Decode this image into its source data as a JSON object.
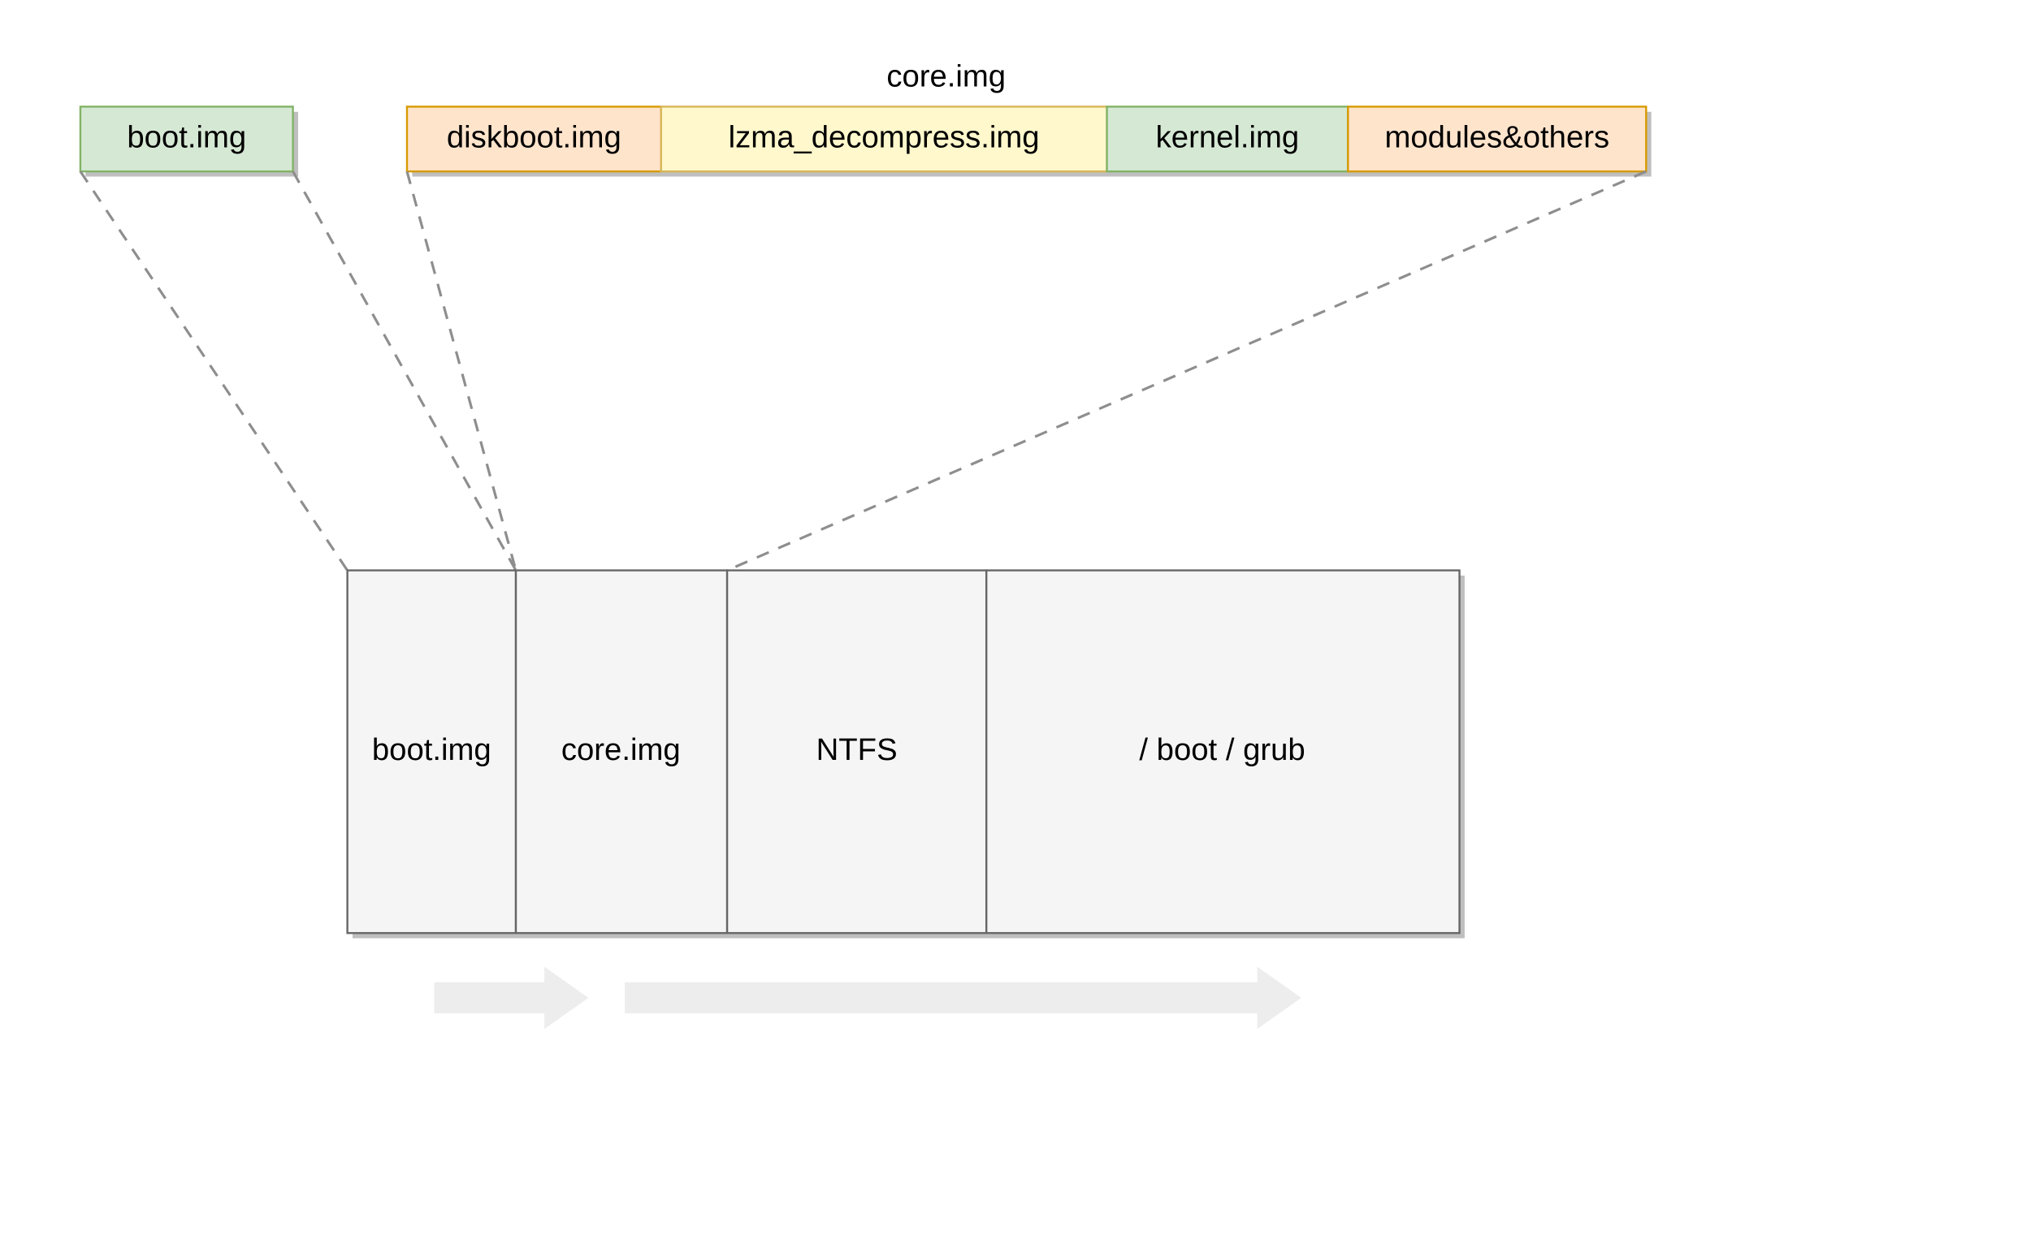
{
  "title": "core.img",
  "top_blocks": {
    "boot": {
      "label": "boot.img"
    },
    "diskboot": {
      "label": "diskboot.img"
    },
    "lzma": {
      "label": "lzma_decompress.img"
    },
    "kernel": {
      "label": "kernel.img"
    },
    "modules": {
      "label": "modules&others"
    }
  },
  "disk_blocks": {
    "boot": {
      "label": "boot.img"
    },
    "core": {
      "label": "core.img"
    },
    "ntfs": {
      "label": "NTFS"
    },
    "grub": {
      "label": "/ boot / grub"
    }
  },
  "colors": {
    "green_fill": "#d5e8d4",
    "green_stroke": "#82b366",
    "orange_fill": "#ffe4cc",
    "orange_stroke": "#d79b00",
    "yellow_fill": "#fff8cc",
    "yellow_stroke": "#d6b656",
    "grey_fill": "#f5f5f5",
    "grey_stroke": "#666666",
    "arrow_fill": "#ededed",
    "shadow": "#bfbfbf",
    "connector": "#8e8e8e"
  }
}
